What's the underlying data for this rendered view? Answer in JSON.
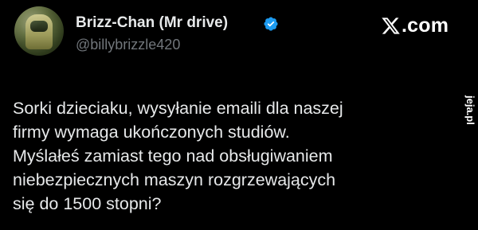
{
  "author": {
    "display_name": "Brizz-Chan (Mr drive)",
    "handle": "@billybrizzle420",
    "verified": true
  },
  "brand": {
    "text": ".com",
    "icon": "x-logo-icon"
  },
  "tweet": {
    "lines": [
      "Sorki dzieciaku, wysyłanie emaili dla naszej",
      "firmy wymaga ukończonych studiów.",
      "Myślałeś zamiast tego nad obsługiwaniem",
      "niebezpiecznych maszyn rozgrzewających",
      "się do 1500 stopni?"
    ]
  },
  "watermark": {
    "text": "jeja.pl"
  },
  "colors": {
    "background": "#000000",
    "primary_text": "#e7e9ea",
    "secondary_text": "#71767b",
    "verified_badge": "#1d9bf0",
    "watermark_accent": "#e2231a"
  }
}
